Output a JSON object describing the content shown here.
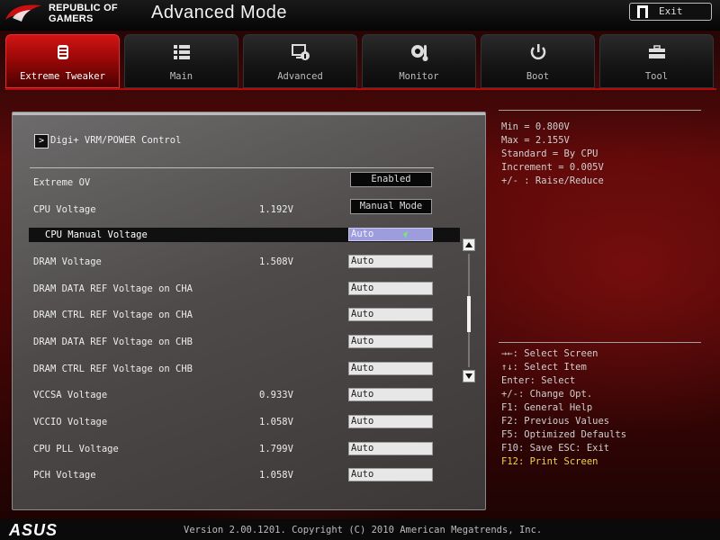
{
  "header": {
    "brand_line1": "REPUBLIC OF",
    "brand_line2": "GAMERS",
    "mode_title": "Advanced Mode",
    "exit_label": "Exit"
  },
  "tabs": [
    {
      "label": "Extreme Tweaker",
      "icon": "tweaker-icon",
      "active": true
    },
    {
      "label": "Main",
      "icon": "list-icon",
      "active": false
    },
    {
      "label": "Advanced",
      "icon": "advanced-icon",
      "active": false
    },
    {
      "label": "Monitor",
      "icon": "monitor-icon",
      "active": false
    },
    {
      "label": "Boot",
      "icon": "power-icon",
      "active": false
    },
    {
      "label": "Tool",
      "icon": "toolbox-icon",
      "active": false
    }
  ],
  "submenu": {
    "label": "Digi+ VRM/POWER Control"
  },
  "settings": [
    {
      "label": "Extreme OV",
      "value": "",
      "option": "Enabled",
      "style": "dark"
    },
    {
      "label": "CPU Voltage",
      "value": "1.192V",
      "option": "Manual Mode",
      "style": "dark"
    },
    {
      "label": "CPU Manual Voltage",
      "value": "",
      "option": "Auto",
      "style": "field",
      "selected": true
    },
    {
      "label": "DRAM Voltage",
      "value": "1.508V",
      "option": "Auto",
      "style": "field"
    },
    {
      "label": "DRAM DATA REF Voltage on CHA",
      "value": "",
      "option": "Auto",
      "style": "field"
    },
    {
      "label": "DRAM CTRL REF Voltage on CHA",
      "value": "",
      "option": "Auto",
      "style": "field"
    },
    {
      "label": "DRAM DATA REF Voltage on CHB",
      "value": "",
      "option": "Auto",
      "style": "field"
    },
    {
      "label": "DRAM CTRL REF Voltage on CHB",
      "value": "",
      "option": "Auto",
      "style": "field"
    },
    {
      "label": "VCCSA Voltage",
      "value": "0.933V",
      "option": "Auto",
      "style": "field"
    },
    {
      "label": "VCCIO Voltage",
      "value": "1.058V",
      "option": "Auto",
      "style": "field"
    },
    {
      "label": "CPU PLL Voltage",
      "value": "1.799V",
      "option": "Auto",
      "style": "field"
    },
    {
      "label": "PCH Voltage",
      "value": "1.058V",
      "option": "Auto",
      "style": "field"
    }
  ],
  "scrollbar": {
    "position": 0.55
  },
  "help": {
    "lines": [
      "Min = 0.800V",
      "Max = 2.155V",
      "Standard = By CPU",
      "Increment = 0.005V",
      "+/- : Raise/Reduce"
    ]
  },
  "keys": {
    "lines": [
      "→←: Select Screen",
      "↑↓: Select Item",
      "Enter: Select",
      "+/-: Change Opt.",
      "F1: General Help",
      "F2: Previous Values",
      "F5: Optimized Defaults",
      "F10: Save  ESC: Exit"
    ],
    "highlight": "F12: Print Screen"
  },
  "footer": {
    "brand": "ASUS",
    "version": "Version 2.00.1201. Copyright (C) 2010 American Megatrends, Inc."
  },
  "colors": {
    "accent": "#c40e0e",
    "highlight": "#f2d24a",
    "selection": "#9d9cdc"
  }
}
